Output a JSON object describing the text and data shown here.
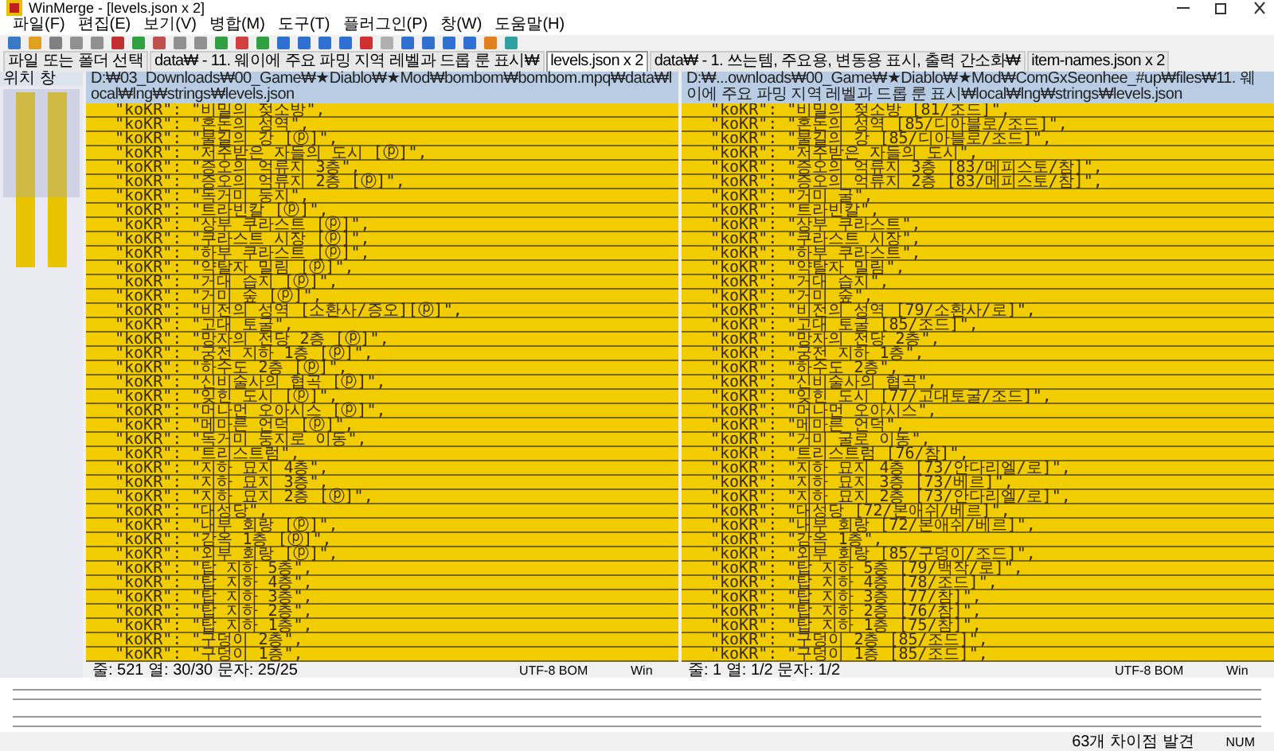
{
  "window": {
    "title": "WinMerge - [levels.json x 2]"
  },
  "menu": [
    "파일(F)",
    "편집(E)",
    "보기(V)",
    "병합(M)",
    "도구(T)",
    "플러그인(P)",
    "창(W)",
    "도움말(H)"
  ],
  "tabs": [
    {
      "label": "파일 또는 폴더 선택",
      "selected": false
    },
    {
      "label": "data₩ - 11. 웨이에 주요 파밍 지역 레벨과 드롭 룬 표시₩",
      "selected": false
    },
    {
      "label": "levels.json x 2",
      "selected": true
    },
    {
      "label": "data₩ - 1. 쓰는템, 주요용, 변동용 표시, 출력 간소화₩",
      "selected": false
    },
    {
      "label": "item-names.json x 2",
      "selected": false
    }
  ],
  "location_pane": {
    "title": "위치 창"
  },
  "panes": [
    {
      "path": "D:₩03_Downloads₩00_Game₩★Diablo₩★Mod₩bombom₩bombom.mpq₩data₩local₩lng₩strings₩levels.json",
      "lines": [
        "\"koKR\": \"비밀의 젖소방\",",
        "\"koKR\": \"혼돈의 성역\",",
        "\"koKR\": \"불길의 강 [ⓟ]\",",
        "\"koKR\": \"저주받은 자들의 도시 [ⓟ]\",",
        "\"koKR\": \"증오의 억류지 3층\",",
        "\"koKR\": \"증오의 억류지 2층 [ⓟ]\",",
        "\"koKR\": \"독거미 둥지\",",
        "\"koKR\": \"트라빈칼 [ⓟ]\",",
        "\"koKR\": \"상부 쿠라스트 [ⓟ]\",",
        "\"koKR\": \"쿠라스트 시장 [ⓟ]\",",
        "\"koKR\": \"하부 쿠라스트 [ⓟ]\",",
        "\"koKR\": \"약탈자 밀림 [ⓟ]\",",
        "\"koKR\": \"거대 습지 [ⓟ]\",",
        "\"koKR\": \"거미 숲 [ⓟ]\",",
        "\"koKR\": \"비전의 성역 [소환사/증오][ⓟ]\",",
        "\"koKR\": \"고대 토굴\",",
        "\"koKR\": \"망자의 전당 2층 [ⓟ]\",",
        "\"koKR\": \"궁전 지하 1층 [ⓟ]\",",
        "\"koKR\": \"하수도 2층 [ⓟ]\",",
        "\"koKR\": \"신비술사의 협곡 [ⓟ]\",",
        "\"koKR\": \"잊힌 도시 [ⓟ]\",",
        "\"koKR\": \"머나먼 오아시스 [ⓟ]\",",
        "\"koKR\": \"메마른 언덕 [ⓟ]\",",
        "\"koKR\": \"독거미 둥지로 이동\",",
        "\"koKR\": \"트리스트럼\",",
        "\"koKR\": \"지하 묘지 4층\",",
        "\"koKR\": \"지하 묘지 3층\",",
        "\"koKR\": \"지하 묘지 2층 [ⓟ]\",",
        "\"koKR\": \"대성당\",",
        "\"koKR\": \"내부 회랑 [ⓟ]\",",
        "\"koKR\": \"감옥 1층 [ⓟ]\",",
        "\"koKR\": \"외부 회랑 [ⓟ]\",",
        "\"koKR\": \"탑 지하 5층\",",
        "\"koKR\": \"탑 지하 4층\",",
        "\"koKR\": \"탑 지하 3층\",",
        "\"koKR\": \"탑 지하 2층\",",
        "\"koKR\": \"탑 지하 1층\",",
        "\"koKR\": \"구덩이 2층\",",
        "\"koKR\": \"구덩이 1층\","
      ],
      "status": {
        "position": "줄: 521  열: 30/30  문자: 25/25",
        "encoding": "UTF-8 BOM",
        "eol": "Win"
      }
    },
    {
      "path": "D:₩...ownloads₩00_Game₩★Diablo₩★Mod₩ComGxSeonhee_#up₩files₩11. 웨이에 주요 파밍 지역 레벨과 드롭 룬 표시₩local₩lng₩strings₩levels.json",
      "lines": [
        "\"koKR\": \"비밀의 젖소방 [81/조드]\",",
        "\"koKR\": \"혼돈의 성역 [85/디아블로/조드]\",",
        "\"koKR\": \"불길의 강 [85/디아블로/조드]\",",
        "\"koKR\": \"저주받은 자들의 도시\",",
        "\"koKR\": \"증오의 억류지 3층 [83/메피스토/참]\",",
        "\"koKR\": \"증오의 억류지 2층 [83/메피스토/참]\",",
        "\"koKR\": \"거미 굴\",",
        "\"koKR\": \"트라빈칼\",",
        "\"koKR\": \"상부 쿠라스트\",",
        "\"koKR\": \"쿠라스트 시장\",",
        "\"koKR\": \"하부 쿠라스트\",",
        "\"koKR\": \"약탈자 밀림\",",
        "\"koKR\": \"거대 습지\",",
        "\"koKR\": \"거미 숲\",",
        "\"koKR\": \"비전의 성역 [79/소환사/로]\",",
        "\"koKR\": \"고대 토굴 [85/조드]\",",
        "\"koKR\": \"망자의 전당 2층\",",
        "\"koKR\": \"궁전 지하 1층\",",
        "\"koKR\": \"하수도 2층\",",
        "\"koKR\": \"신비술사의 협곡\",",
        "\"koKR\": \"잊힌 도시 [77/고대토굴/조드]\",",
        "\"koKR\": \"머나먼 오아시스\",",
        "\"koKR\": \"메마른 언덕\",",
        "\"koKR\": \"거미 굴로 이동\",",
        "\"koKR\": \"트리스트럼 [76/참]\",",
        "\"koKR\": \"지하 묘지 4층 [73/안다리엘/로]\",",
        "\"koKR\": \"지하 묘지 3층 [73/베르]\",",
        "\"koKR\": \"지하 묘지 2층 [73/안다리엘/로]\",",
        "\"koKR\": \"대성당 [72/본애쉬/베르]\",",
        "\"koKR\": \"내부 회랑 [72/본애쉬/베르]\",",
        "\"koKR\": \"감옥 1층\",",
        "\"koKR\": \"외부 회랑 [85/구덩이/조드]\",",
        "\"koKR\": \"탑 지하 5층 [79/백작/로]\",",
        "\"koKR\": \"탑 지하 4층 [78/조드]\",",
        "\"koKR\": \"탑 지하 3층 [77/참]\",",
        "\"koKR\": \"탑 지하 2층 [76/참]\",",
        "\"koKR\": \"탑 지하 1층 [75/참]\",",
        "\"koKR\": \"구덩이 2층 [85/조드]\",",
        "\"koKR\": \"구덩이 1층 [85/조드]\","
      ],
      "status": {
        "position": "줄: 1  열: 1/2  문자: 1/2",
        "encoding": "UTF-8 BOM",
        "eol": "Win"
      }
    }
  ],
  "status_bar": {
    "message": "63개 차이점 발견",
    "num": "NUM"
  }
}
